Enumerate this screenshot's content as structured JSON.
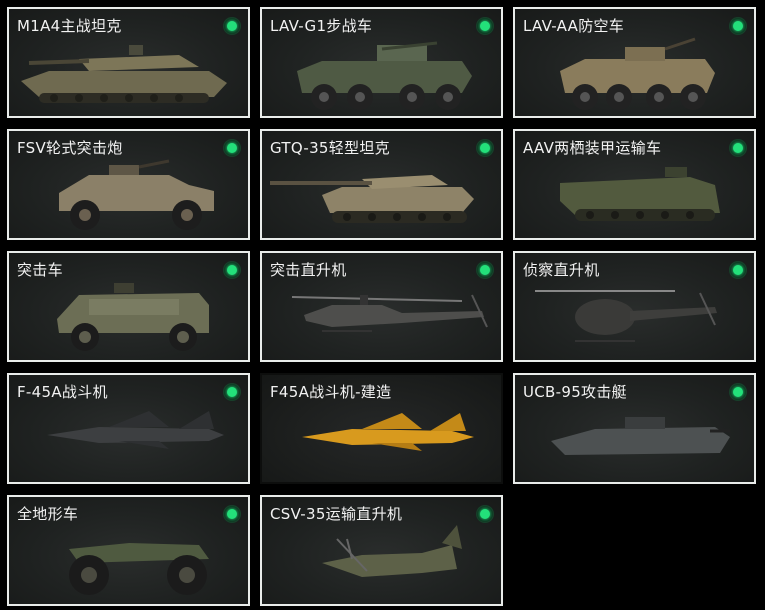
{
  "vehicles": [
    {
      "title": "M1A4主战坦克",
      "status_icon": "green-status-dot",
      "icon": "main-battle-tank"
    },
    {
      "title": "LAV-G1步战车",
      "status_icon": "green-status-dot",
      "icon": "wheeled-ifv"
    },
    {
      "title": "LAV-AA防空车",
      "status_icon": "green-status-dot",
      "icon": "wheeled-anti-air"
    },
    {
      "title": "FSV轮式突击炮",
      "status_icon": "green-status-dot",
      "icon": "armored-car"
    },
    {
      "title": "GTQ-35轻型坦克",
      "status_icon": "green-status-dot",
      "icon": "light-tank"
    },
    {
      "title": "AAV两栖装甲运输车",
      "status_icon": "green-status-dot",
      "icon": "amphibious-apc"
    },
    {
      "title": "突击车",
      "status_icon": "green-status-dot",
      "icon": "assault-truck"
    },
    {
      "title": "突击直升机",
      "status_icon": "green-status-dot",
      "icon": "attack-helicopter"
    },
    {
      "title": "侦察直升机",
      "status_icon": "green-status-dot",
      "icon": "scout-helicopter"
    },
    {
      "title": "F-45A战斗机",
      "status_icon": "green-status-dot",
      "icon": "fighter-jet"
    },
    {
      "title": "F45A战斗机-建造",
      "status_icon": "none",
      "icon": "fighter-jet-yellow"
    },
    {
      "title": "UCB-95攻击艇",
      "status_icon": "green-status-dot",
      "icon": "attack-boat"
    },
    {
      "title": "全地形车",
      "status_icon": "green-status-dot",
      "icon": "atv"
    },
    {
      "title": "CSV-35运输直升机",
      "status_icon": "green-status-dot",
      "icon": "tiltrotor"
    }
  ],
  "colors": {
    "border": "#e9ecea",
    "status_green": "#23e07a",
    "background": "#000000"
  }
}
